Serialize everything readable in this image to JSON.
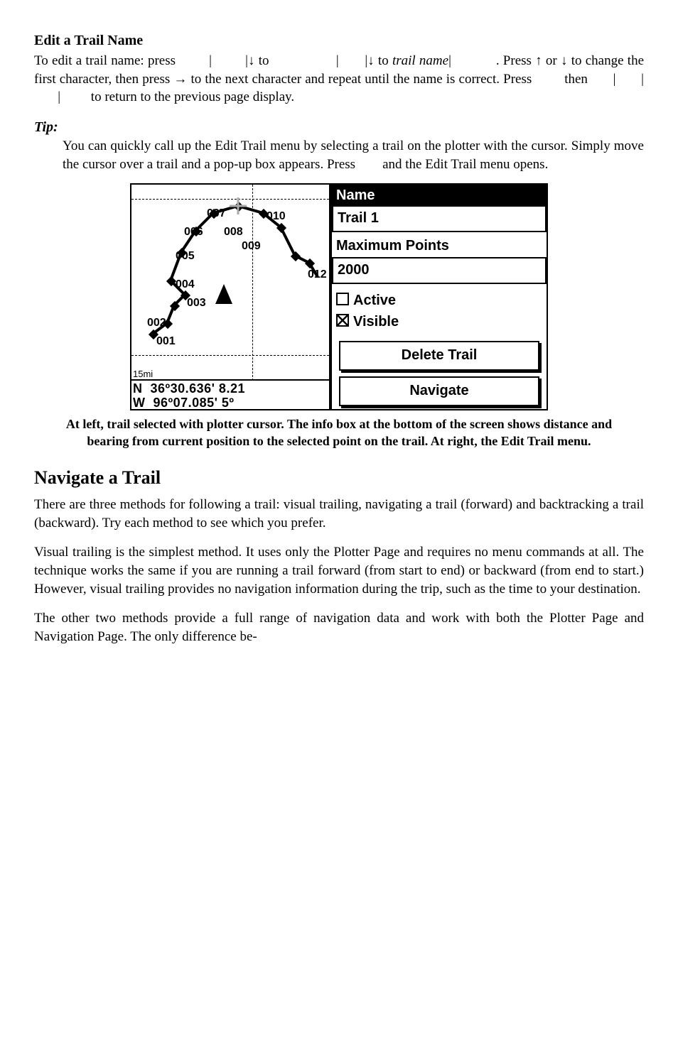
{
  "section_title": "Edit a Trail Name",
  "para_edit": "To edit a trail name: press          |          |↓ to                   |        |↓ to trail name|             . Press ↑ or ↓ to change the first character, then press → to the next character and repeat until the name is correct. Press         then        |        |        |          to return to the previous page display.",
  "tip_label": "Tip:",
  "tip_body": "You can quickly call up the Edit Trail menu by selecting a trail on the plotter with the cursor. Simply move the cursor over a trail and a pop-up box appears. Press          and the Edit Trail menu opens.",
  "plotter": {
    "waypoints": [
      "001",
      "002",
      "003",
      "004",
      "005",
      "006",
      "007",
      "008",
      "009",
      "010",
      "012"
    ],
    "scale": "15mi",
    "coord1": "N  36º30.636' 8.21",
    "coord2": "W  96º07.085' 5º"
  },
  "menu": {
    "name_label": "Name",
    "name_value": "Trail 1",
    "max_label": "Maximum Points",
    "max_value": "2000",
    "active_label": "Active",
    "visible_label": "Visible",
    "delete_btn": "Delete Trail",
    "navigate_btn": "Navigate"
  },
  "caption": "At left, trail selected with plotter cursor. The info box at the bottom of the screen shows distance and bearing from current position to the selected point on the trail. At right, the Edit Trail menu.",
  "nav_heading": "Navigate a Trail",
  "nav_p1": "There are three methods for following a trail: visual trailing, navigating a trail (forward) and backtracking a trail (backward). Try each method to see which you prefer.",
  "nav_p2": "Visual trailing is the simplest method. It uses only the Plotter Page and requires no menu commands at all. The technique works the same if you are running a trail forward (from start to end) or backward (from end to start.) However, visual trailing provides no navigation information during the trip, such as the time to your destination.",
  "nav_p3": "The other two methods provide a full range of navigation data and work with both the Plotter Page and Navigation Page. The only difference be-"
}
